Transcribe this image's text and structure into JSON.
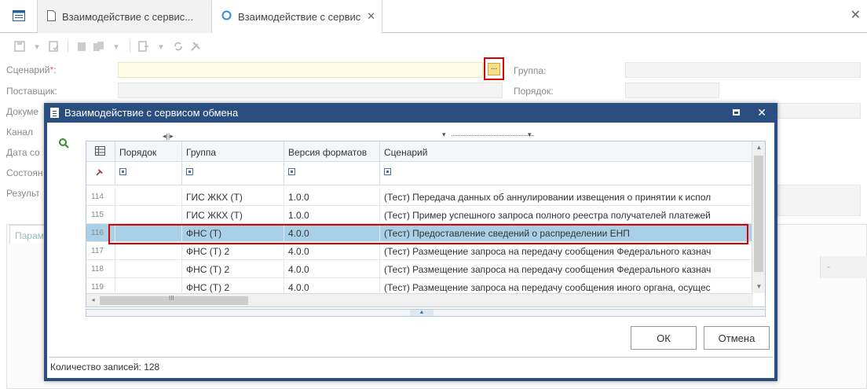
{
  "tabs": {
    "home_icon": "list-icon",
    "tab1": "Взаимодействие с сервис...",
    "tab2": "Взаимодействие с сервис",
    "close": "✕"
  },
  "window": {
    "close": "✕"
  },
  "form": {
    "scenario_label": "Сценарий",
    "scenario_required": "*",
    "scenario_colon": ":",
    "supplier_label": "Поставщик:",
    "document_label": "Докуме",
    "channel_label": "Канал",
    "date_label": "Дата со",
    "state_label": "Состоян",
    "result_label": "Результ",
    "group_label": "Группа:",
    "order_label": "Порядок:",
    "dots_button": "...",
    "params_tab": "Парам",
    "right_col_marker": "-"
  },
  "dialog": {
    "title": "Взаимодействие с сервисом обмена",
    "columns": [
      "Порядок",
      "Группа",
      "Версия форматов",
      "Сценарий"
    ],
    "rows": [
      {
        "num": "114",
        "order": "",
        "group": "ГИС ЖКХ (Т)",
        "version": "1.0.0",
        "scenario": "(Тест) Передача данных об аннулировании извещения о принятии к испол"
      },
      {
        "num": "115",
        "order": "",
        "group": "ГИС ЖКХ (Т)",
        "version": "1.0.0",
        "scenario": "(Тест) Пример успешного запроса полного реестра получателей платежей"
      },
      {
        "num": "116",
        "order": "",
        "group": "ФНС (Т)",
        "version": "4.0.0",
        "scenario": "(Тест) Предоставление сведений о распределении ЕНП"
      },
      {
        "num": "117",
        "order": "",
        "group": "ФНС (Т) 2",
        "version": "4.0.0",
        "scenario": "(Тест) Размещение запроса на передачу сообщения Федерального казнач"
      },
      {
        "num": "118",
        "order": "",
        "group": "ФНС (Т) 2",
        "version": "4.0.0",
        "scenario": "(Тест) Размещение запроса на передачу сообщения Федерального казнач"
      },
      {
        "num": "119",
        "order": "",
        "group": "ФНС (Т) 2",
        "version": "4.0.0",
        "scenario": "(Тест) Размещение запроса на передачу сообщения иного органа, осущес"
      }
    ],
    "selected_row": 2,
    "ok": "ОК",
    "cancel": "Отмена",
    "status": "Количество записей: 128",
    "maximize_icon": "maximize-icon",
    "close": "✕",
    "hscroll_grip": "III"
  },
  "colors": {
    "accent": "#2a4e7f",
    "selection": "#a8d1e8",
    "highlight": "#d00000"
  }
}
